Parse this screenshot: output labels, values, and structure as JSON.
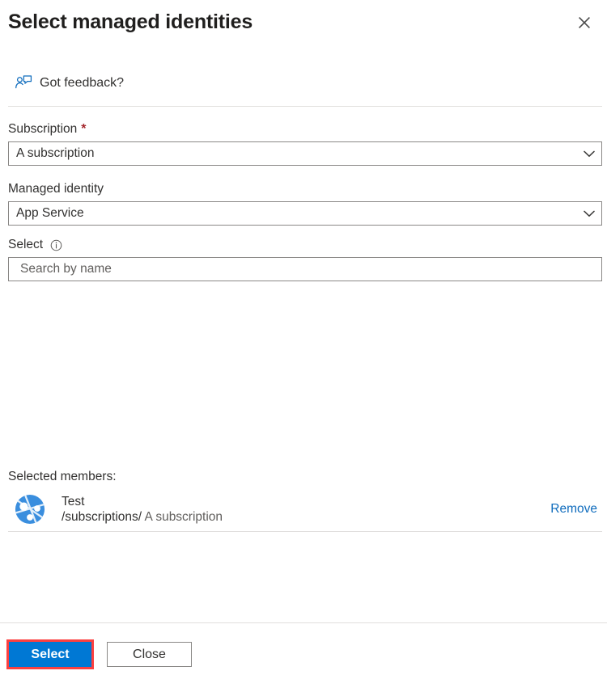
{
  "panel": {
    "title": "Select managed identities",
    "close_icon": "close-x-icon"
  },
  "feedback": {
    "label": "Got feedback?",
    "icon": "feedback-person-icon"
  },
  "form": {
    "subscription": {
      "label": "Subscription",
      "required_mark": "*",
      "value": "A subscription",
      "chevron_icon": "chevron-down-icon"
    },
    "managed_identity": {
      "label": "Managed identity",
      "value": "App Service",
      "chevron_icon": "chevron-down-icon"
    },
    "select": {
      "label": "Select",
      "info_icon": "info-circle-icon",
      "search_value": "",
      "search_placeholder": "Search by name"
    }
  },
  "selected_members": {
    "title": "Selected members:",
    "items": [
      {
        "avatar_icon": "managed-identity-avatar-icon",
        "name": "Test",
        "path": "/subscriptions/",
        "scope": "A subscription",
        "remove_label": "Remove"
      }
    ]
  },
  "footer": {
    "primary_label": "Select",
    "secondary_label": "Close"
  },
  "colors": {
    "accent": "#0078d4",
    "link": "#0f6cbd",
    "required": "#a4262c",
    "highlight": "#fc4040",
    "border": "#8a8886",
    "divider": "#e1dfdd",
    "text": "#323130",
    "muted": "#605e5c"
  }
}
